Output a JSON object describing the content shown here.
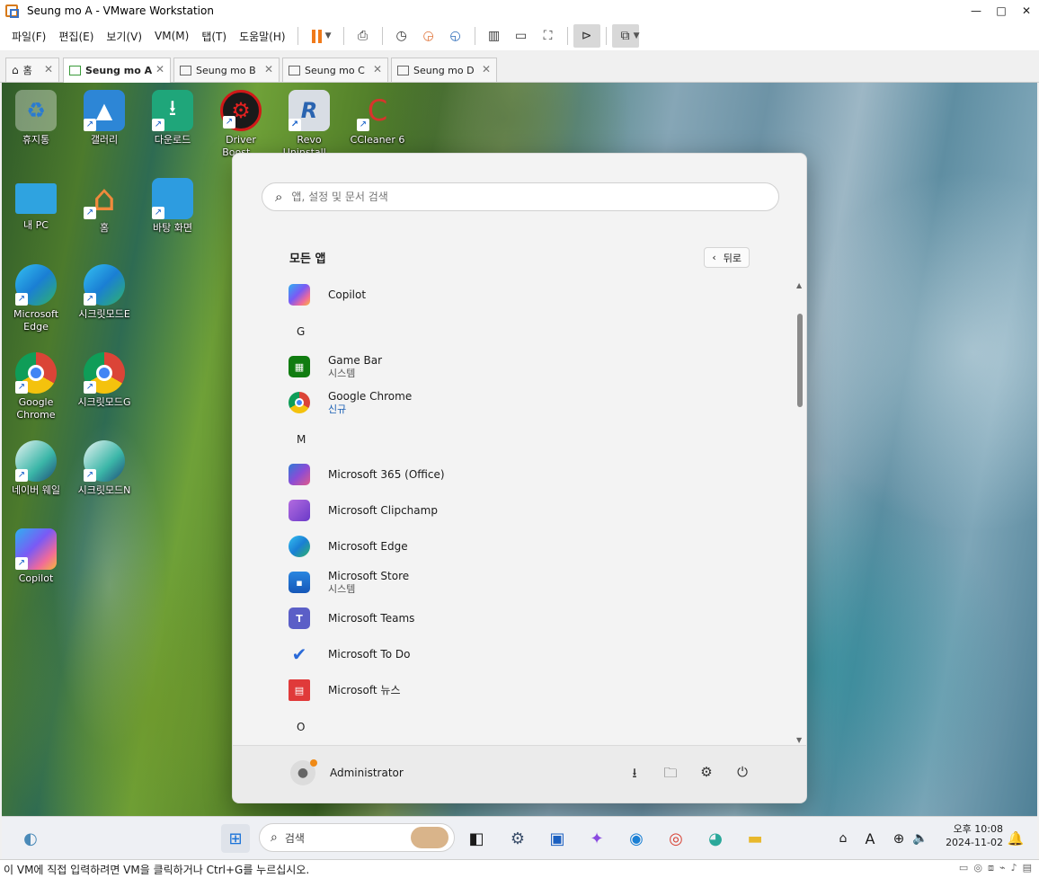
{
  "window": {
    "title": "Seung mo A - VMware Workstation",
    "minimize": "—",
    "maximize": "□",
    "close": "✕"
  },
  "menu": [
    "파일(F)",
    "편집(E)",
    "보기(V)",
    "VM(M)",
    "탭(T)",
    "도움말(H)"
  ],
  "tabs": [
    {
      "label": "홈",
      "active": false
    },
    {
      "label": "Seung mo A",
      "active": true
    },
    {
      "label": "Seung mo B",
      "active": false
    },
    {
      "label": "Seung mo C",
      "active": false
    },
    {
      "label": "Seung mo D",
      "active": false
    }
  ],
  "desktop_icons": [
    {
      "label": "휴지통",
      "icon": "recycle-bin-icon"
    },
    {
      "label": "갤러리",
      "icon": "gallery-icon"
    },
    {
      "label": "다운로드",
      "icon": "downloads-folder-icon"
    },
    {
      "label": "Driver Boost...",
      "icon": "driver-booster-icon"
    },
    {
      "label": "Revo Uninstall...",
      "icon": "revo-uninstaller-icon"
    },
    {
      "label": "CCleaner 6",
      "icon": "ccleaner-icon"
    },
    {
      "label": "내 PC",
      "icon": "this-pc-icon"
    },
    {
      "label": "홈",
      "icon": "home-icon"
    },
    {
      "label": "바탕 화면",
      "icon": "desktop-folder-icon"
    },
    {
      "label": "Microsoft Edge",
      "icon": "edge-icon"
    },
    {
      "label": "시크릿모드E",
      "icon": "edge-icon"
    },
    {
      "label": "Google Chrome",
      "icon": "chrome-icon"
    },
    {
      "label": "시크릿모드G",
      "icon": "chrome-icon"
    },
    {
      "label": "네이버 웨일",
      "icon": "whale-icon"
    },
    {
      "label": "시크릿모드N",
      "icon": "whale-icon"
    },
    {
      "label": "Copilot",
      "icon": "copilot-icon"
    }
  ],
  "start_menu": {
    "search_placeholder": "앱, 설정 및 문서 검색",
    "section_title": "모든 앱",
    "back_label": "뒤로",
    "apps": [
      {
        "name": "Copilot",
        "icon": "copilot-icon"
      },
      {
        "letter": "G"
      },
      {
        "name": "Game Bar",
        "sub": "시스템",
        "icon": "game-bar-icon"
      },
      {
        "name": "Google Chrome",
        "sub": "신규",
        "icon": "chrome-icon"
      },
      {
        "letter": "M"
      },
      {
        "name": "Microsoft 365 (Office)",
        "icon": "m365-icon"
      },
      {
        "name": "Microsoft Clipchamp",
        "icon": "clipchamp-icon"
      },
      {
        "name": "Microsoft Edge",
        "icon": "edge-icon"
      },
      {
        "name": "Microsoft Store",
        "sub": "시스템",
        "icon": "store-icon"
      },
      {
        "name": "Microsoft Teams",
        "icon": "teams-icon"
      },
      {
        "name": "Microsoft To Do",
        "icon": "todo-icon"
      },
      {
        "name": "Microsoft 뉴스",
        "icon": "news-icon"
      },
      {
        "letter": "O"
      }
    ],
    "user": "Administrator"
  },
  "taskbar": {
    "search_label": "검색",
    "time": "오후 10:08",
    "date": "2024-11-02",
    "ime": "A"
  },
  "status_bar": "이 VM에 직접 입력하려면 VM을 클릭하거나 Ctrl+G를 누르십시오."
}
